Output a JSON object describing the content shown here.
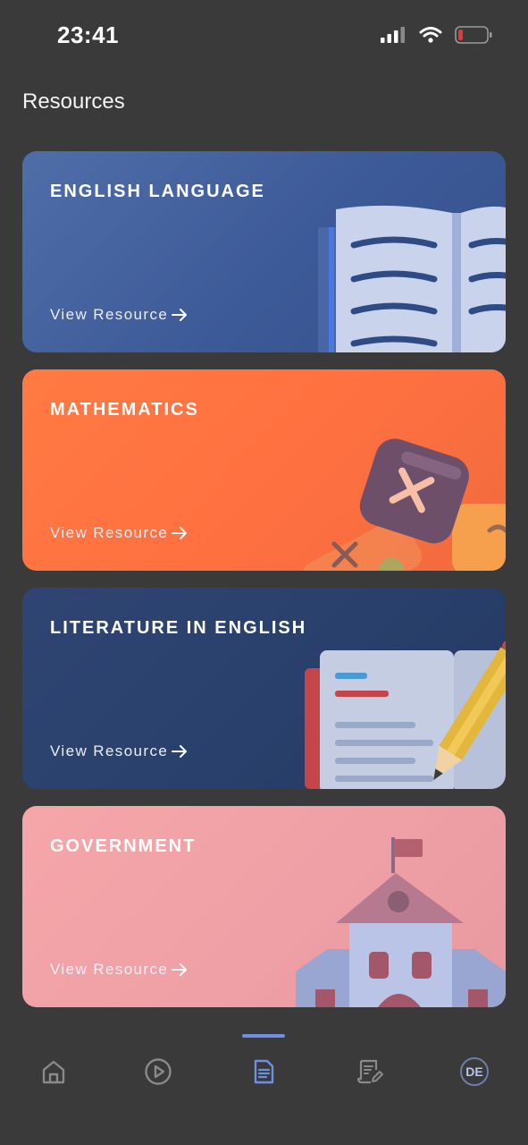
{
  "status_bar": {
    "time": "23:41",
    "icons": [
      "signal-icon",
      "wifi-icon",
      "battery-low-icon"
    ],
    "battery_color": "#e53935"
  },
  "page": {
    "title": "Resources"
  },
  "cards": [
    {
      "title": "ENGLISH LANGUAGE",
      "link": "View Resource",
      "icon": "open-book-icon",
      "color": "#3d5a98"
    },
    {
      "title": "MATHEMATICS",
      "link": "View Resource",
      "icon": "calculator-icon",
      "color": "#ff7040"
    },
    {
      "title": "LITERATURE IN ENGLISH",
      "link": "View Resource",
      "icon": "notebook-pencil-icon",
      "color": "#29406c"
    },
    {
      "title": "GOVERNMENT",
      "link": "View Resource",
      "icon": "government-building-icon",
      "color": "#eea0a6"
    }
  ],
  "bottom_nav": {
    "active": "resources",
    "accent": "#6f8fe0",
    "items": [
      {
        "id": "home",
        "icon": "home-icon"
      },
      {
        "id": "videos",
        "icon": "play-circle-icon"
      },
      {
        "id": "resources",
        "icon": "document-icon"
      },
      {
        "id": "exams",
        "icon": "edit-document-icon"
      },
      {
        "id": "profile",
        "avatar_initials": "DE"
      }
    ]
  }
}
